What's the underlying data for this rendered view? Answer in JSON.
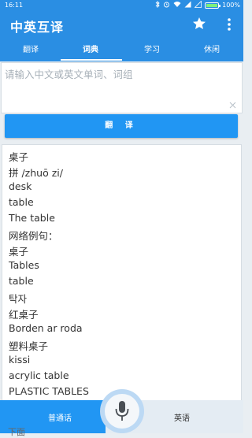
{
  "status_bar": {
    "time": "16:11",
    "battery": "100%"
  },
  "app_bar": {
    "title": "中英互译"
  },
  "tabs": [
    {
      "label": "翻译"
    },
    {
      "label": "词典"
    },
    {
      "label": "学习"
    },
    {
      "label": "休闲"
    }
  ],
  "active_tab": 1,
  "input": {
    "placeholder": "请输入中文或英文单词、词组",
    "value": ""
  },
  "translate_button": "翻 译",
  "results": [
    "桌子",
    "拼 /zhuō zi/",
    "desk",
    "table",
    "The table",
    "网络例句：",
    "桌子",
    "Tables",
    "table",
    "탁자",
    "红桌子",
    "Borden ar roda",
    "塑料桌子",
    "kissi",
    "acrylic table",
    "PLASTIC TABLES"
  ],
  "bottom_bar": {
    "left_language": "普通话",
    "right_language": "英语",
    "partial_text": "下面"
  },
  "colors": {
    "primary": "#2a8ee3",
    "button": "#2196f3",
    "battery_fill": "#7cf07c"
  },
  "icons": [
    "star-icon",
    "more-vert-icon",
    "close-icon",
    "microphone-icon",
    "bluetooth-icon",
    "alarm-icon",
    "signal-icon",
    "wifi-icon",
    "battery-icon"
  ]
}
